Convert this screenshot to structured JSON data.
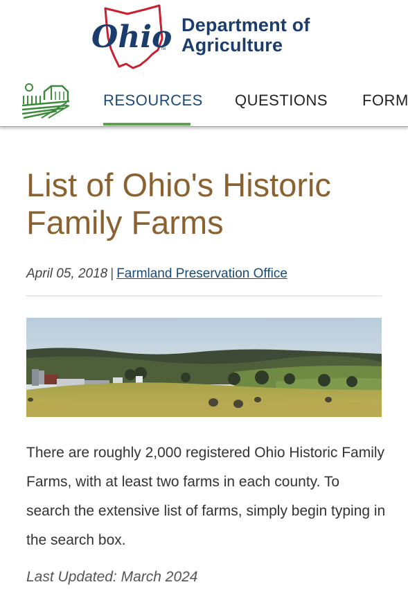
{
  "header": {
    "logo_text": "Ohio",
    "dept_line1": "Department of",
    "dept_line2": "Agriculture"
  },
  "nav": {
    "items": [
      {
        "label": "RESOURCES",
        "active": true
      },
      {
        "label": "QUESTIONS",
        "active": false
      },
      {
        "label": "FORMS",
        "active": false
      }
    ]
  },
  "article": {
    "title": "List of Ohio's Historic Family Farms",
    "date": "April 05, 2018",
    "separator": "|",
    "author_link": "Farmland Preservation Office",
    "body": "There are roughly 2,000 registered Ohio Historic Family Farms, with at least two farms in each county. To search the extensive list of farms, simply begin typing in the search box.",
    "last_updated": "Last Updated: March 2024"
  },
  "colors": {
    "title_brown": "#8a6130",
    "nav_blue": "#1a4a75",
    "accent_green": "#5aa34a",
    "logo_red": "#c8202f"
  }
}
